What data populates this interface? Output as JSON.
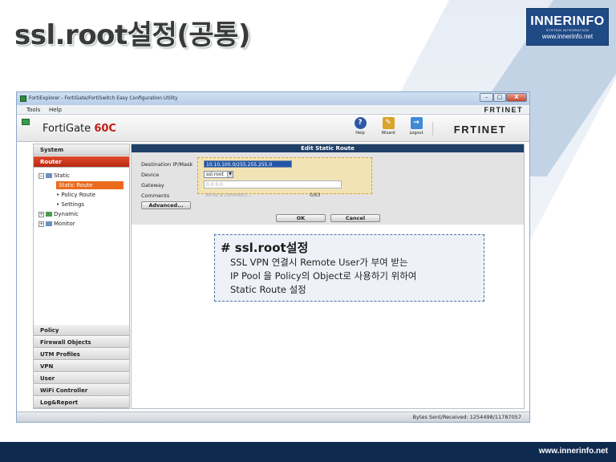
{
  "slide_title": "ssl.root설정(공통)",
  "logo": {
    "name": "INNERINFO",
    "tagline": "SYSTEM INTEGRATION",
    "url": "www.innerinfo.net"
  },
  "footer_url": "www.innerinfo.net",
  "window": {
    "title": "FortiExplorer - FortiGate/FortiSwitch Easy Configuration Utility",
    "controls": [
      "–",
      "□",
      "X"
    ]
  },
  "menu": [
    "Tools",
    "Help"
  ],
  "brand": "FRTINET",
  "header": {
    "device_name": "FortiGate",
    "device_model": "60C",
    "buttons": [
      "Help",
      "Wizard",
      "Logout"
    ],
    "icons": [
      "help-icon",
      "wizard-icon",
      "logout-icon"
    ]
  },
  "sidebar": {
    "top_sections": [
      "System",
      "Router"
    ],
    "tree": {
      "static": "Static",
      "static_route": "Static Route",
      "policy_route": "Policy Route",
      "settings": "Settings",
      "dynamic": "Dynamic",
      "monitor": "Monitor"
    },
    "bottom_sections": [
      "Policy",
      "Firewall Objects",
      "UTM Profiles",
      "VPN",
      "User",
      "WiFi Controller",
      "Log&Report"
    ]
  },
  "dialog": {
    "title": "Edit Static Route",
    "labels": [
      "Destination IP/Mask",
      "Device",
      "Gateway",
      "Comments"
    ],
    "destination_value": "10.10.100.0/255.255.255.0",
    "device_value": "ssl.root",
    "gateway_placeholder": "0.0.0.0",
    "comment_placeholder": "Write a comment...",
    "comment_count": "0/63",
    "advanced_label": "Advanced...",
    "ok_label": "OK",
    "cancel_label": "Cancel"
  },
  "callout": {
    "title": "# ssl.root설정",
    "lines": [
      "SSL VPN 연결시  Remote User가 부여 받는",
      "IP Pool 을 Policy의 Object로  사용하기 위하여",
      "Static Route 설정"
    ]
  },
  "status": "Bytes Sent/Received: 1254498/11787057",
  "colors": {
    "accent_red": "#c0201a",
    "selected_orange": "#ea6a1e",
    "dialog_header": "#1f3f66",
    "footer_bar": "#0f2a4f"
  }
}
